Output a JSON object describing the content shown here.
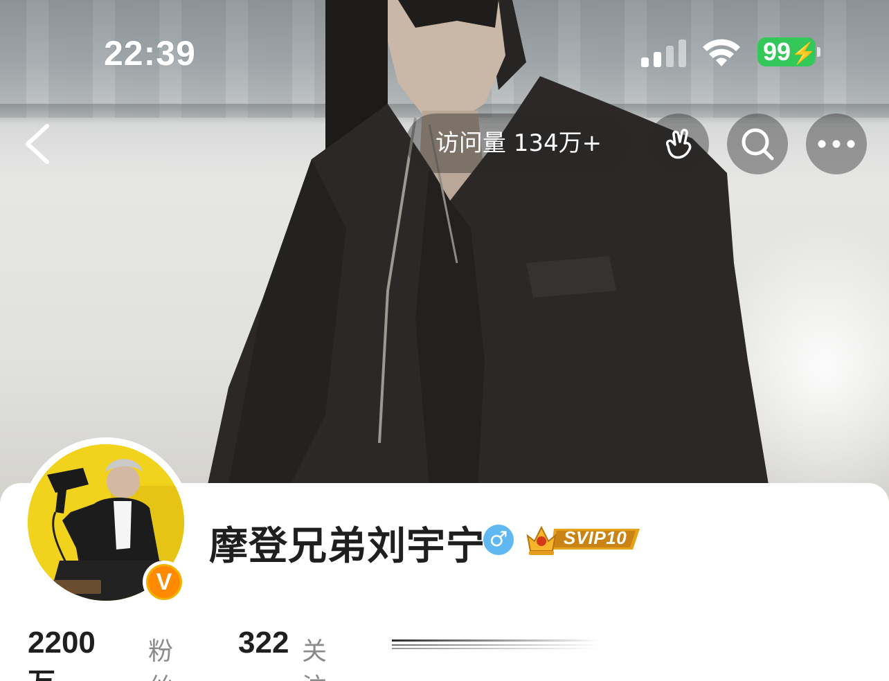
{
  "status_bar": {
    "time": "22:39",
    "battery": "99"
  },
  "nav": {
    "visit_count": "访问量 134万+"
  },
  "profile": {
    "username": "摩登兄弟刘宇宁",
    "gender": "♂",
    "verified_mark": "V",
    "vip_level": "SVIP10"
  },
  "stats": {
    "followers_value": "2200",
    "followers_unit": "万",
    "followers_label": "粉丝",
    "following_value": "322",
    "following_label": "关注"
  },
  "icons": {
    "back": "back-icon",
    "hand": "finger-heart-icon",
    "search": "search-icon",
    "more": "more-icon",
    "signal": "signal-icon",
    "wifi": "wifi-icon"
  },
  "colors": {
    "battery": "#34c759",
    "verified": "#ff8a00",
    "gender": "#5fb8f2",
    "vip_gold": "#e8a21a"
  }
}
